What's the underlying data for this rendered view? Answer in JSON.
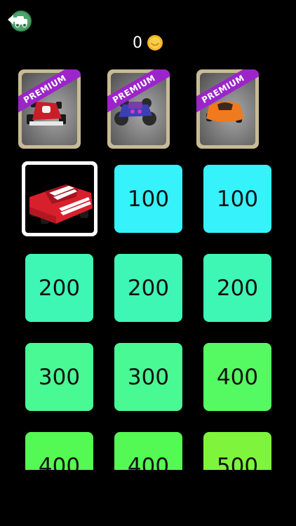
{
  "coins": {
    "count": "0",
    "icon": "coin-icon"
  },
  "back": {
    "icon": "garage-back-icon"
  },
  "premium": [
    {
      "label": "PREMIUM",
      "car": "formula-race-car"
    },
    {
      "label": "PREMIUM",
      "car": "monster-truck"
    },
    {
      "label": "PREMIUM",
      "car": "orange-sports-car"
    }
  ],
  "tiles": [
    {
      "kind": "owned",
      "car": "red-striped-car",
      "color": "#ffffff"
    },
    {
      "price": "100",
      "color": "#35f2fb"
    },
    {
      "price": "100",
      "color": "#35f2fb"
    },
    {
      "price": "200",
      "color": "#3ef7b4"
    },
    {
      "price": "200",
      "color": "#3ef7b4"
    },
    {
      "price": "200",
      "color": "#3ef7b4"
    },
    {
      "price": "300",
      "color": "#49f994"
    },
    {
      "price": "300",
      "color": "#49f994"
    },
    {
      "price": "400",
      "color": "#55f962"
    },
    {
      "price": "400",
      "color": "#55f953"
    },
    {
      "price": "400",
      "color": "#55f953"
    },
    {
      "price": "500",
      "color": "#7ef53c"
    }
  ]
}
